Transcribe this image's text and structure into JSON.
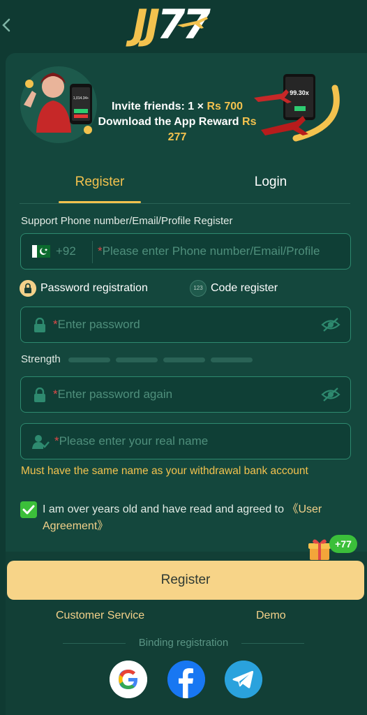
{
  "header": {
    "logo_text_a": "JJ",
    "logo_text_b": "77"
  },
  "banner": {
    "line1_prefix": "Invite friends: 1 × ",
    "line1_amount": "Rs 700",
    "line2_prefix": "Download the App Reward ",
    "line2_amount": "Rs 277",
    "phone1_value": "1,014.34+",
    "phone2_value": "99.30x"
  },
  "tabs": {
    "register": "Register",
    "login": "Login"
  },
  "form": {
    "support_label": "Support Phone number/Email/Profile Register",
    "country_code": "+92",
    "phone_placeholder": "Please enter Phone number/Email/Profile",
    "password_registration": "Password registration",
    "code_register": "Code register",
    "code_icon_text": "123",
    "password_placeholder": "Enter password",
    "strength_label": "Strength",
    "password_again_placeholder": "Enter password again",
    "realname_placeholder": "Please enter your real name",
    "name_warning": "Must have the same name as your withdrawal bank account",
    "agree_text": "I am over years old and have read and agreed to ",
    "agree_link": "《User Agreement》",
    "register_button": "Register",
    "bonus_badge": "+77"
  },
  "footer": {
    "customer_service": "Customer Service",
    "demo": "Demo",
    "binding_label": "Binding registration"
  },
  "colors": {
    "background": "#0f3a32",
    "accent": "#f3c24e",
    "button": "#f7d488",
    "checkbox": "#3bbf3a"
  }
}
